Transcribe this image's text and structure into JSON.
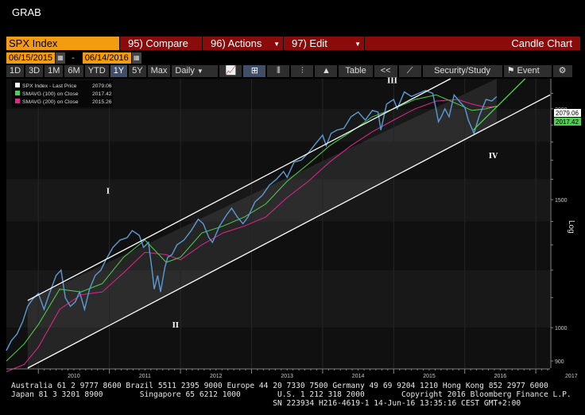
{
  "app": {
    "title": "GRAB"
  },
  "toolbar1": {
    "security": "SPX Index",
    "compare": "95) Compare",
    "actions": "96) Actions",
    "edit": "97) Edit",
    "chart_type": "Candle Chart"
  },
  "date_range": {
    "start": "06/15/2015",
    "end": "06/14/2016"
  },
  "periods": [
    "1D",
    "3D",
    "1M",
    "6M",
    "YTD",
    "1Y",
    "5Y",
    "Max"
  ],
  "active_period": "1Y",
  "toolbar3": {
    "frequency": "Daily",
    "table": "Table",
    "back": "<<",
    "security_study": "Security/Study",
    "event": "Event"
  },
  "legend": [
    {
      "label": "SPX Index - Last Price",
      "value": "2079.06",
      "color": "#ffffff"
    },
    {
      "label": "SMAVG (100) on Close",
      "value": "2017.42",
      "color": "#4ed24e"
    },
    {
      "label": "SMAVG (200) on Close",
      "value": "2015.26",
      "color": "#e0288c"
    }
  ],
  "last_price_tag": "2079.06",
  "sma_tag": "2017.42",
  "wave_labels": [
    "I",
    "II",
    "III",
    "IV"
  ],
  "axis_title": "Log",
  "colors": {
    "accent": "#f39c12",
    "red_bar": "#8b0a0a",
    "price": "#5b9bd5",
    "sma100": "#4ed24e",
    "sma200": "#e0288c",
    "channel": "#ffffff"
  },
  "footer": {
    "line1": "Australia 61 2 9777 8600 Brazil 5511 2395 9000 Europe 44 20 7330 7500 Germany 49 69 9204 1210 Hong Kong 852 2977 6000",
    "line2": "Japan 81 3 3201 8900        Singapore 65 6212 1000        U.S. 1 212 318 2000        Copyright 2016 Bloomberg Finance L.P.",
    "line3": "                                                         SN 223934 H216-4619-1 14-Jun-16 13:35:16 CEST GMT+2:00"
  },
  "chart_data": {
    "type": "line",
    "scale": "log",
    "y_ticks": [
      900,
      1000,
      1500,
      2000
    ],
    "x_ticks": [
      "2010",
      "2011",
      "2012",
      "2013",
      "2014",
      "2015",
      "2016",
      "2017"
    ],
    "ylim": [
      880,
      2200
    ],
    "xlim": [
      2009.55,
      2017.2
    ],
    "price": {
      "name": "SPX Index - Last Price",
      "x": [
        2009.55,
        2009.62,
        2009.7,
        2009.78,
        2009.85,
        2009.92,
        2010.0,
        2010.08,
        2010.15,
        2010.25,
        2010.32,
        2010.38,
        2010.45,
        2010.52,
        2010.58,
        2010.65,
        2010.72,
        2010.8,
        2010.88,
        2010.95,
        2011.05,
        2011.15,
        2011.25,
        2011.32,
        2011.42,
        2011.48,
        2011.55,
        2011.6,
        2011.63,
        2011.68,
        2011.72,
        2011.78,
        2011.82,
        2011.88,
        2011.95,
        2012.05,
        2012.15,
        2012.25,
        2012.32,
        2012.4,
        2012.45,
        2012.55,
        2012.65,
        2012.72,
        2012.8,
        2012.88,
        2012.95,
        2013.05,
        2013.15,
        2013.25,
        2013.35,
        2013.45,
        2013.5,
        2013.6,
        2013.7,
        2013.8,
        2013.9,
        2014.0,
        2014.05,
        2014.12,
        2014.2,
        2014.3,
        2014.4,
        2014.5,
        2014.6,
        2014.7,
        2014.78,
        2014.82,
        2014.9,
        2015.0,
        2015.05,
        2015.15,
        2015.25,
        2015.35,
        2015.45,
        2015.55,
        2015.6,
        2015.63,
        2015.67,
        2015.72,
        2015.78,
        2015.85,
        2015.92,
        2016.0,
        2016.05,
        2016.1,
        2016.13,
        2016.2,
        2016.3,
        2016.38,
        2016.45
      ],
      "values": [
        930,
        960,
        980,
        1020,
        1070,
        1095,
        1115,
        1060,
        1110,
        1180,
        1200,
        1100,
        1070,
        1085,
        1120,
        1060,
        1130,
        1180,
        1200,
        1240,
        1290,
        1320,
        1330,
        1360,
        1340,
        1290,
        1310,
        1200,
        1130,
        1180,
        1120,
        1210,
        1250,
        1260,
        1300,
        1320,
        1360,
        1410,
        1390,
        1330,
        1310,
        1380,
        1430,
        1460,
        1420,
        1390,
        1420,
        1490,
        1520,
        1570,
        1600,
        1640,
        1610,
        1690,
        1700,
        1740,
        1790,
        1840,
        1780,
        1850,
        1870,
        1880,
        1950,
        1980,
        1930,
        1990,
        1980,
        1870,
        2030,
        2060,
        2000,
        2110,
        2080,
        2100,
        2120,
        2100,
        1990,
        1920,
        1950,
        2000,
        1950,
        2090,
        2050,
        2010,
        1930,
        1880,
        1850,
        1950,
        2060,
        2050,
        2079
      ]
    },
    "sma100": {
      "name": "SMAVG (100) on Close",
      "x": [
        2009.55,
        2009.8,
        2010.0,
        2010.3,
        2010.6,
        2010.9,
        2011.2,
        2011.5,
        2011.8,
        2012.0,
        2012.3,
        2012.6,
        2012.9,
        2013.2,
        2013.5,
        2013.8,
        2014.1,
        2014.4,
        2014.7,
        2015.0,
        2015.3,
        2015.6,
        2015.9,
        2016.1,
        2016.3,
        2016.45
      ],
      "values": [
        900,
        950,
        1010,
        1130,
        1120,
        1150,
        1250,
        1320,
        1230,
        1250,
        1350,
        1380,
        1420,
        1480,
        1590,
        1680,
        1780,
        1860,
        1950,
        2000,
        2060,
        2090,
        2030,
        1990,
        2000,
        2017
      ]
    },
    "sma200": {
      "name": "SMAVG (200) on Close",
      "x": [
        2009.55,
        2009.8,
        2010.0,
        2010.3,
        2010.6,
        2010.9,
        2011.2,
        2011.5,
        2011.8,
        2012.0,
        2012.3,
        2012.6,
        2012.9,
        2013.2,
        2013.5,
        2013.8,
        2014.1,
        2014.4,
        2014.7,
        2015.0,
        2015.3,
        2015.6,
        2015.9,
        2016.1,
        2016.3,
        2016.45
      ],
      "values": [
        870,
        890,
        940,
        1060,
        1110,
        1120,
        1190,
        1270,
        1260,
        1240,
        1300,
        1350,
        1380,
        1420,
        1510,
        1590,
        1690,
        1780,
        1860,
        1930,
        2000,
        2050,
        2060,
        2030,
        2010,
        2015
      ]
    },
    "channel_upper": {
      "x": [
        2009.85,
        2015.8
      ],
      "values": [
        1090,
        2200
      ]
    },
    "channel_lower": {
      "x": [
        2009.85,
        2017.2
      ],
      "values": [
        880,
        2090
      ]
    },
    "breakout_line": {
      "x": [
        2016.12,
        2016.85
      ],
      "values": [
        1870,
        2200
      ]
    },
    "wave_positions": [
      {
        "label": "I",
        "x": 2010.98,
        "y": 1530
      },
      {
        "label": "II",
        "x": 2011.93,
        "y": 1000
      },
      {
        "label": "III",
        "x": 2014.98,
        "y": 2170
      },
      {
        "label": "IV",
        "x": 2016.4,
        "y": 1710
      }
    ]
  }
}
